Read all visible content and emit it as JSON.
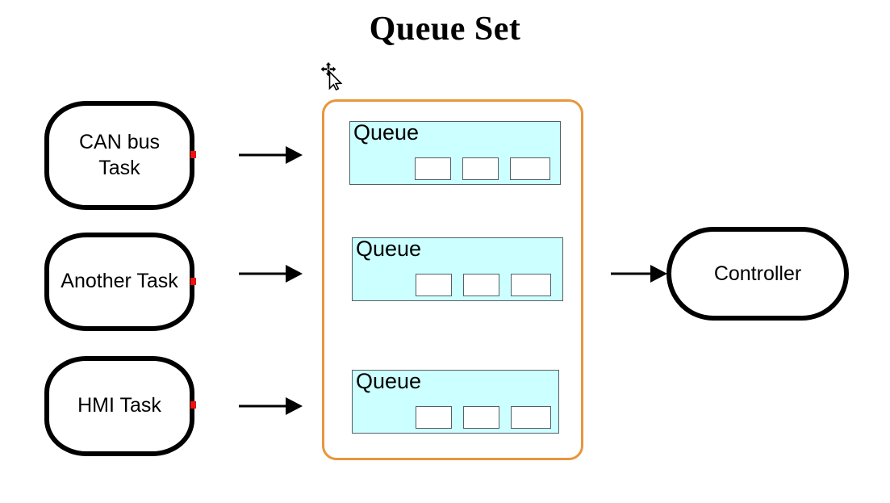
{
  "title": "Queue Set",
  "colors": {
    "queue_fill": "#CCFFFF",
    "queue_border": "#555F66",
    "container_border": "#E8963C",
    "shape_border": "#000000",
    "connector_dot": "#EE1111",
    "background": "#FFFFFF"
  },
  "tasks": [
    {
      "label": "CAN bus\nTask"
    },
    {
      "label": "Another Task"
    },
    {
      "label": "HMI Task"
    }
  ],
  "queue_set": {
    "queues": [
      {
        "label": "Queue",
        "slots": [
          "",
          "",
          ""
        ]
      },
      {
        "label": "Queue",
        "slots": [
          "",
          "",
          ""
        ]
      },
      {
        "label": "Queue",
        "slots": [
          "",
          "",
          ""
        ]
      }
    ]
  },
  "consumer": {
    "label": "Controller"
  },
  "arrows": [
    {
      "name": "can-bus-task-to-queue-set"
    },
    {
      "name": "another-task-to-queue-set"
    },
    {
      "name": "hmi-task-to-queue-set"
    },
    {
      "name": "queue-set-to-controller"
    }
  ],
  "cursor": {
    "type": "move-cursor"
  }
}
